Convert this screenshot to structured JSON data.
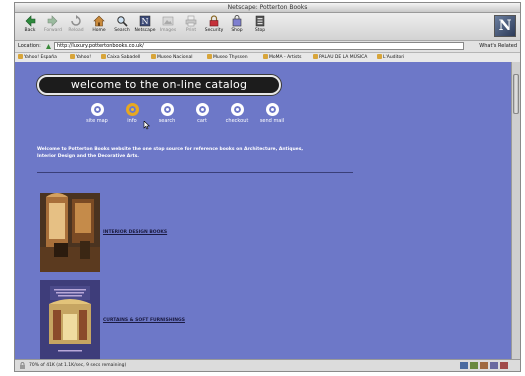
{
  "window": {
    "title": "Netscape: Potterton Books"
  },
  "toolbar": {
    "buttons": [
      {
        "label": "Back",
        "enabled": true
      },
      {
        "label": "Forward",
        "enabled": false
      },
      {
        "label": "Reload",
        "enabled": false
      },
      {
        "label": "Home",
        "enabled": true
      },
      {
        "label": "Search",
        "enabled": true
      },
      {
        "label": "Netscape",
        "enabled": true
      },
      {
        "label": "Images",
        "enabled": false
      },
      {
        "label": "Print",
        "enabled": false
      },
      {
        "label": "Security",
        "enabled": true
      },
      {
        "label": "Shop",
        "enabled": true
      },
      {
        "label": "Stop",
        "enabled": true
      }
    ]
  },
  "location": {
    "label": "Location:",
    "url": "http://luxury.pottertonbooks.co.uk/",
    "related": "What's Related"
  },
  "personal_toolbar": {
    "items": [
      "Yahoo! España",
      "Yahoo!",
      "Caixa Sabadell",
      "Museo Nacional",
      "Museo Thyssen",
      "MoMA - Artists",
      "PALAU DE LA MÚSICA",
      "L'Auditori"
    ]
  },
  "page": {
    "banner": "welcome to the on-line catalog",
    "nav": [
      {
        "label": "site map",
        "active": false
      },
      {
        "label": "info",
        "active": true
      },
      {
        "label": "search",
        "active": false
      },
      {
        "label": "cart",
        "active": false
      },
      {
        "label": "checkout",
        "active": false
      },
      {
        "label": "send mail",
        "active": false
      }
    ],
    "intro_line1": "Welcome to Potterton Books website the one stop source for reference books on Architecture, Antiques,",
    "intro_line2": "Interior Design and the Decorative Arts.",
    "categories": [
      {
        "link": "INTERIOR DESIGN BOOKS"
      },
      {
        "link": "CURTAINS & SOFT FURNISHINGS"
      }
    ]
  },
  "status": {
    "text": "70% of 41K (at 1.1K/sec, 9 secs remaining)"
  },
  "colors": {
    "page_bg": "#6d78c8",
    "banner_bg": "#1c1c1c",
    "active_nav": "#f0c030"
  }
}
